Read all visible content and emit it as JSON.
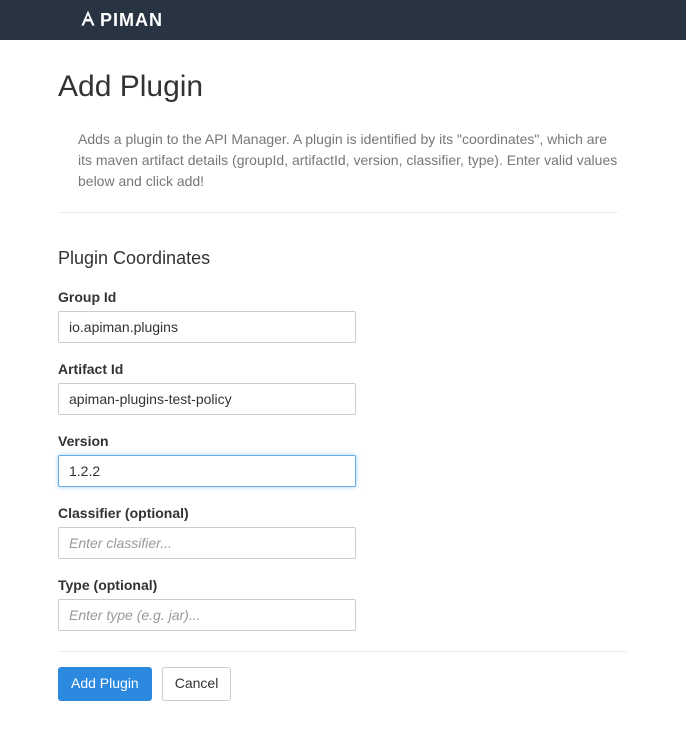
{
  "logo": {
    "text": "PIMAN"
  },
  "page": {
    "title": "Add Plugin",
    "description": "Adds a plugin to the API Manager. A plugin is identified by its \"coordinates\", which are its maven artifact details (groupId, artifactId, version, classifier, type). Enter valid values below and click add!",
    "section_title": "Plugin Coordinates"
  },
  "form": {
    "group_id": {
      "label": "Group Id",
      "value": "io.apiman.plugins"
    },
    "artifact_id": {
      "label": "Artifact Id",
      "value": "apiman-plugins-test-policy"
    },
    "version": {
      "label": "Version",
      "value": "1.2.2"
    },
    "classifier": {
      "label": "Classifier (optional)",
      "value": "",
      "placeholder": "Enter classifier..."
    },
    "type": {
      "label": "Type (optional)",
      "value": "",
      "placeholder": "Enter type (e.g. jar)..."
    }
  },
  "buttons": {
    "add": "Add Plugin",
    "cancel": "Cancel"
  }
}
